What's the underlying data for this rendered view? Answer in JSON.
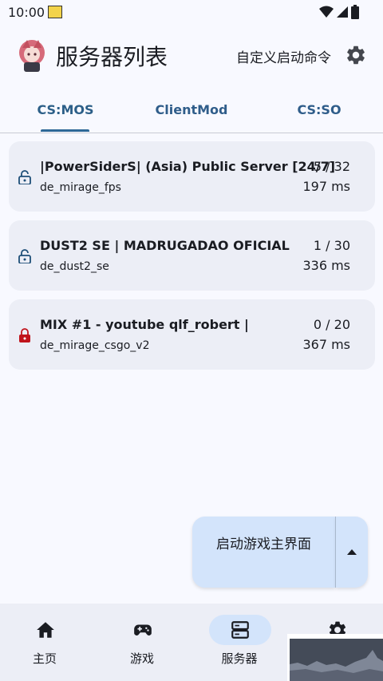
{
  "status": {
    "time": "10:00"
  },
  "header": {
    "title": "服务器列表",
    "custom_command": "自定义启动命令"
  },
  "tabs": [
    {
      "label": "CS:MOS",
      "active": true
    },
    {
      "label": "ClientMod",
      "active": false
    },
    {
      "label": "CS:SO",
      "active": false
    }
  ],
  "servers": [
    {
      "name": "|PowerSiderS| (Asia) Public Server [24/7]",
      "map": "de_mirage_fps",
      "players": "5 / 32",
      "ping": "197 ms",
      "locked": false
    },
    {
      "name": "DUST2 SE | MADRUGADAO OFICIAL",
      "map": "de_dust2_se",
      "players": "1 / 30",
      "ping": "336 ms",
      "locked": false
    },
    {
      "name": "MIX #1 - youtube qlf_robert |",
      "map": "de_mirage_csgo_v2",
      "players": "0 / 20",
      "ping": "367 ms",
      "locked": true
    }
  ],
  "launch": {
    "label": "启动游戏主界面"
  },
  "nav": [
    {
      "label": "主页",
      "icon": "home-icon",
      "active": false
    },
    {
      "label": "游戏",
      "icon": "gamepad-icon",
      "active": false
    },
    {
      "label": "服务器",
      "icon": "server-icon",
      "active": true
    },
    {
      "label": "",
      "icon": "settings-icon",
      "active": false
    }
  ],
  "colors": {
    "accent": "#2e6897",
    "locked": "#c0141c",
    "unlocked": "#1e4f78",
    "card": "#eceef6",
    "pill": "#d3e4fb"
  }
}
